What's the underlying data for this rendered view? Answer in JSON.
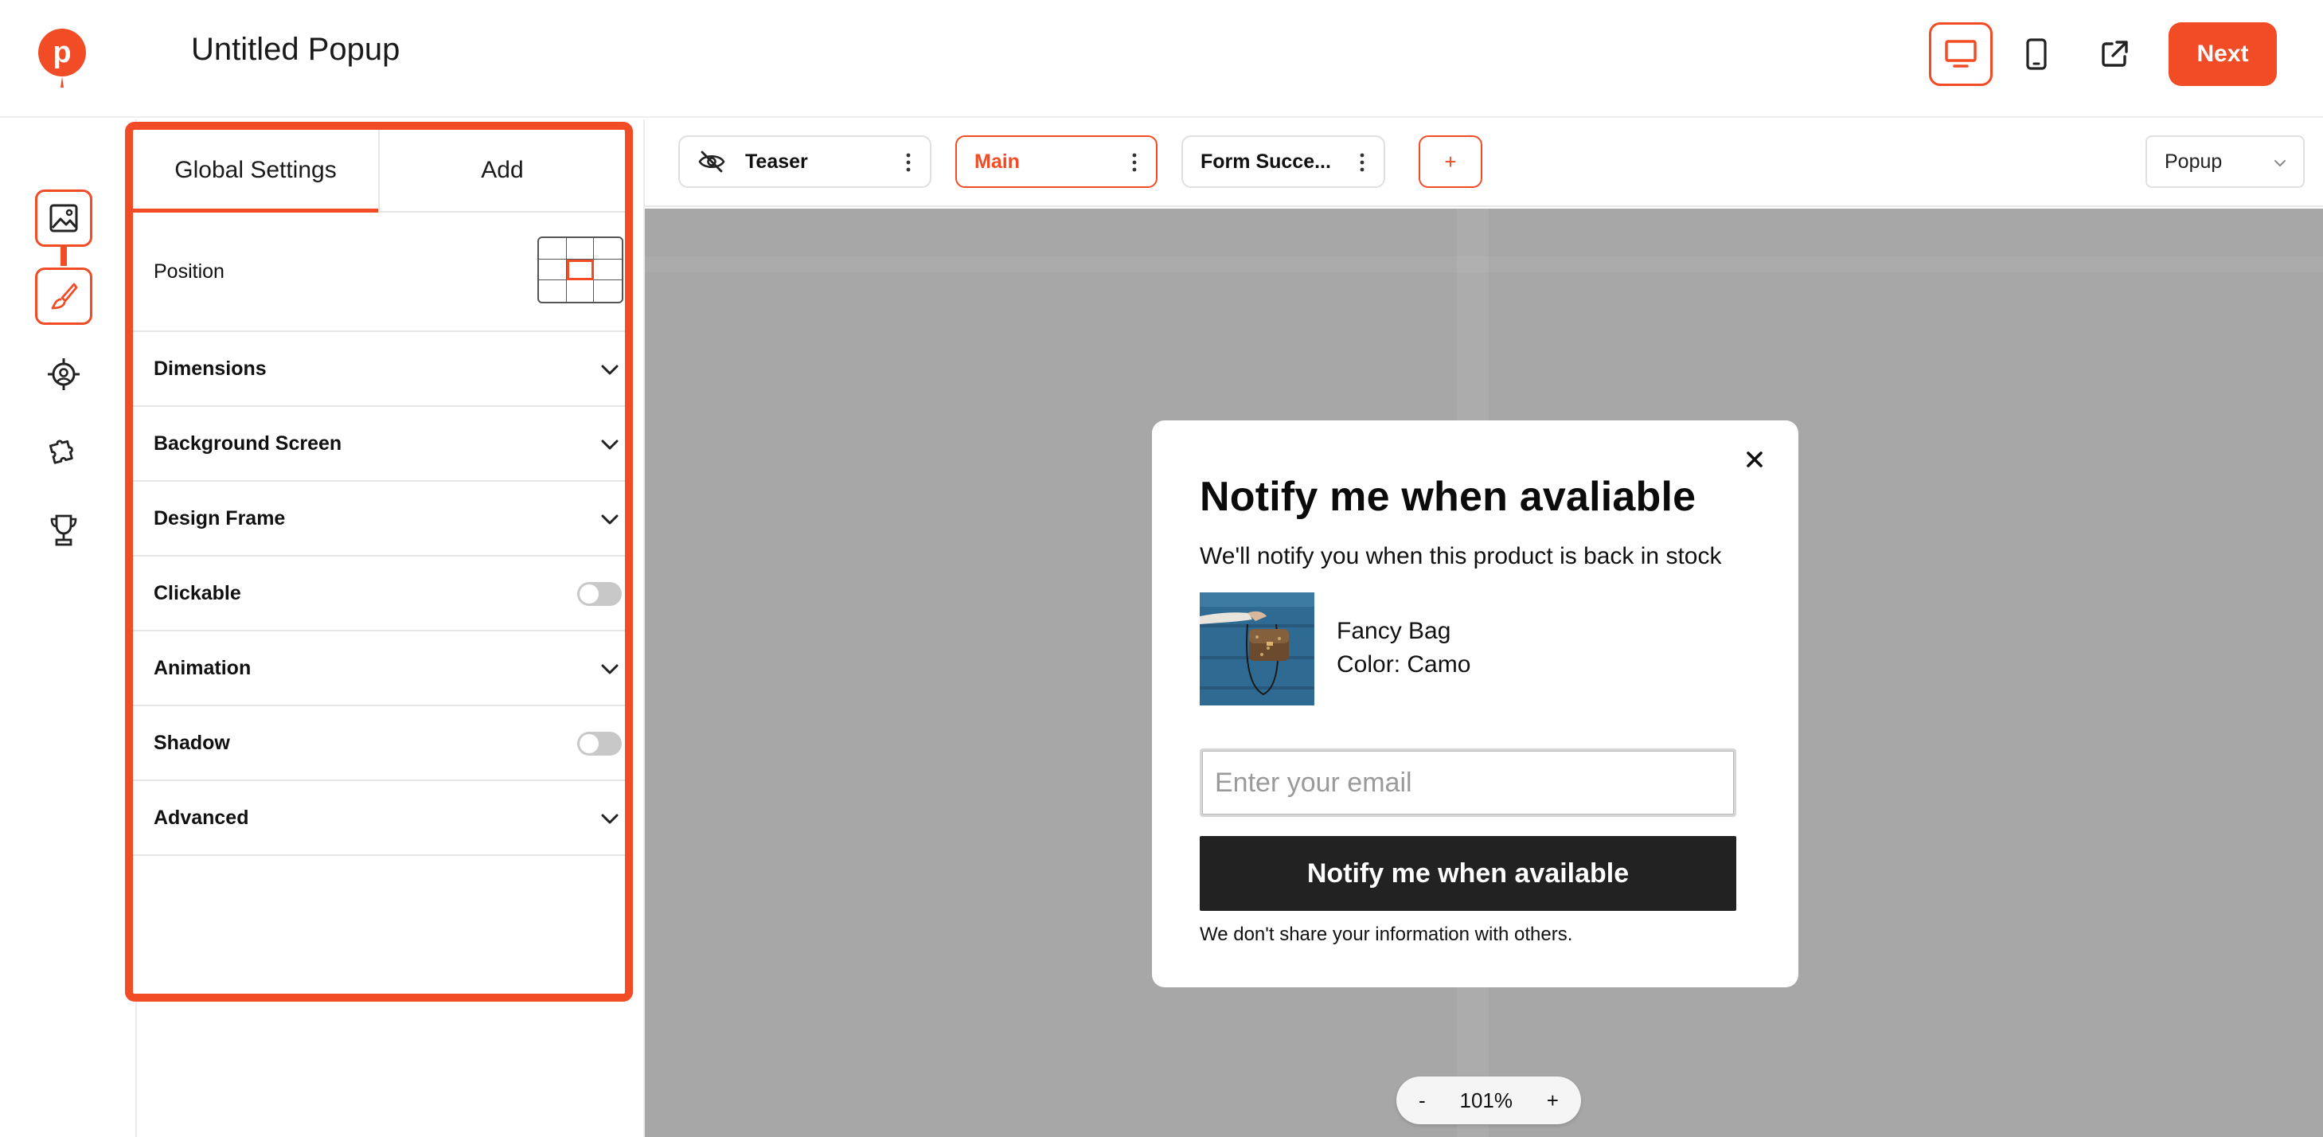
{
  "header": {
    "title": "Untitled Popup",
    "next_label": "Next"
  },
  "rail": {
    "items": [
      "image-icon",
      "brush-icon",
      "target-icon",
      "puzzle-icon",
      "trophy-icon"
    ]
  },
  "panel": {
    "tabs": [
      {
        "label": "Global Settings",
        "active": true
      },
      {
        "label": "Add",
        "active": false
      }
    ],
    "position_label": "Position",
    "rows": {
      "dimensions": "Dimensions",
      "background_screen": "Background Screen",
      "design_frame": "Design Frame",
      "clickable": "Clickable",
      "animation": "Animation",
      "shadow": "Shadow",
      "advanced": "Advanced"
    },
    "toggles": {
      "clickable": false,
      "shadow": false
    }
  },
  "steps": {
    "tabs": [
      {
        "label": "Teaser",
        "hidden": true,
        "active": false
      },
      {
        "label": "Main",
        "active": true
      },
      {
        "label": "Form Succe...",
        "active": false
      }
    ],
    "add_label": "+",
    "type_select": "Popup"
  },
  "popup": {
    "title": "Notify me when avaliable",
    "subtitle": "We'll notify you when this product is back in stock",
    "product_name": "Fancy Bag",
    "product_color": "Color: Camo",
    "email_placeholder": "Enter your email",
    "button_label": "Notify me when available",
    "disclaimer": "We don't share your information with others."
  },
  "zoom": {
    "minus": "-",
    "level": "101%",
    "plus": "+"
  },
  "colors": {
    "accent": "#f24c26",
    "canvas_bg": "#a7a7a7",
    "button_dark": "#222222"
  }
}
